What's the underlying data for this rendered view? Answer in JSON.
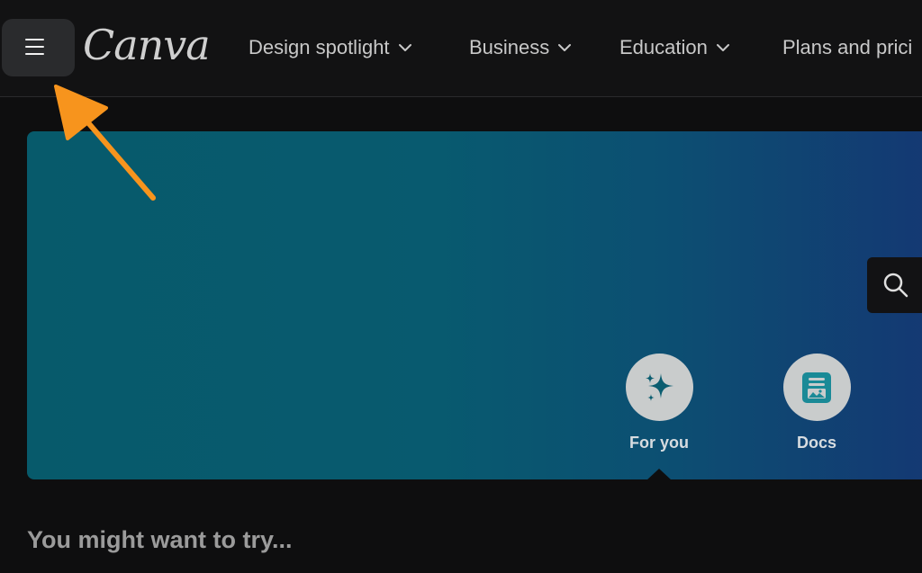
{
  "header": {
    "logo_text": "Canva",
    "menu_icon": "hamburger-menu-icon",
    "nav": [
      {
        "label": "Design spotlight"
      },
      {
        "label": "Business"
      },
      {
        "label": "Education"
      },
      {
        "label": "Plans and prici"
      }
    ]
  },
  "hero": {
    "search_icon": "search-icon",
    "categories": [
      {
        "label": "For you",
        "icon": "sparkle-icon"
      },
      {
        "label": "Docs",
        "icon": "doc-icon"
      }
    ]
  },
  "main": {
    "section_title": "You might want to try..."
  },
  "colors": {
    "annotation_arrow": "#f7941d",
    "hero_start": "#075a6b",
    "hero_end": "#143873",
    "docs_icon": "#1a8a97",
    "foryou_icon": "#0b5d70"
  }
}
